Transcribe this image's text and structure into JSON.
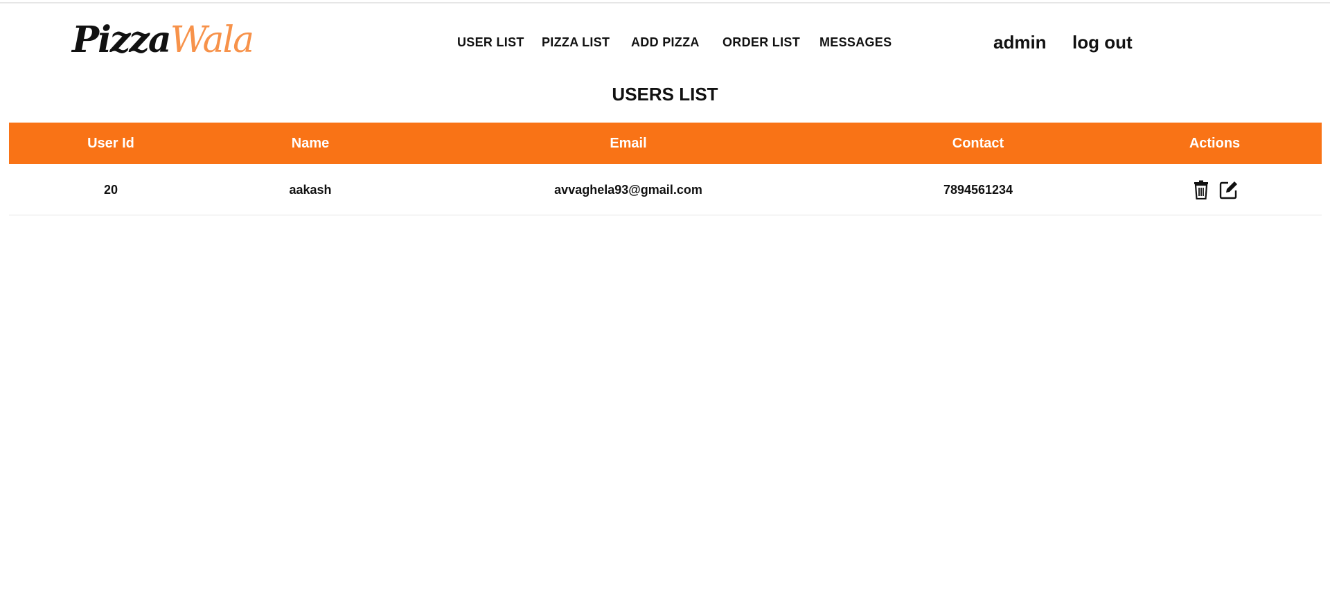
{
  "brand": {
    "part1": "Pizza",
    "part2": "Wala",
    "accent": "#f7924a"
  },
  "nav": {
    "items": [
      {
        "label": "USER LIST"
      },
      {
        "label": "PIZZA LIST"
      },
      {
        "label": "ADD PIZZA"
      },
      {
        "label": "ORDER LIST"
      },
      {
        "label": "MESSAGES"
      }
    ]
  },
  "user": {
    "name": "admin",
    "logout": "log out"
  },
  "page": {
    "title": "USERS LIST"
  },
  "table": {
    "header_color": "#f97316",
    "columns": [
      "User Id",
      "Name",
      "Email",
      "Contact",
      "Actions"
    ],
    "rows": [
      {
        "id": "20",
        "name": "aakash",
        "email": "avvaghela93@gmail.com",
        "contact": "7894561234",
        "actions": [
          {
            "icon": "trash-icon"
          },
          {
            "icon": "edit-icon"
          }
        ]
      }
    ]
  }
}
